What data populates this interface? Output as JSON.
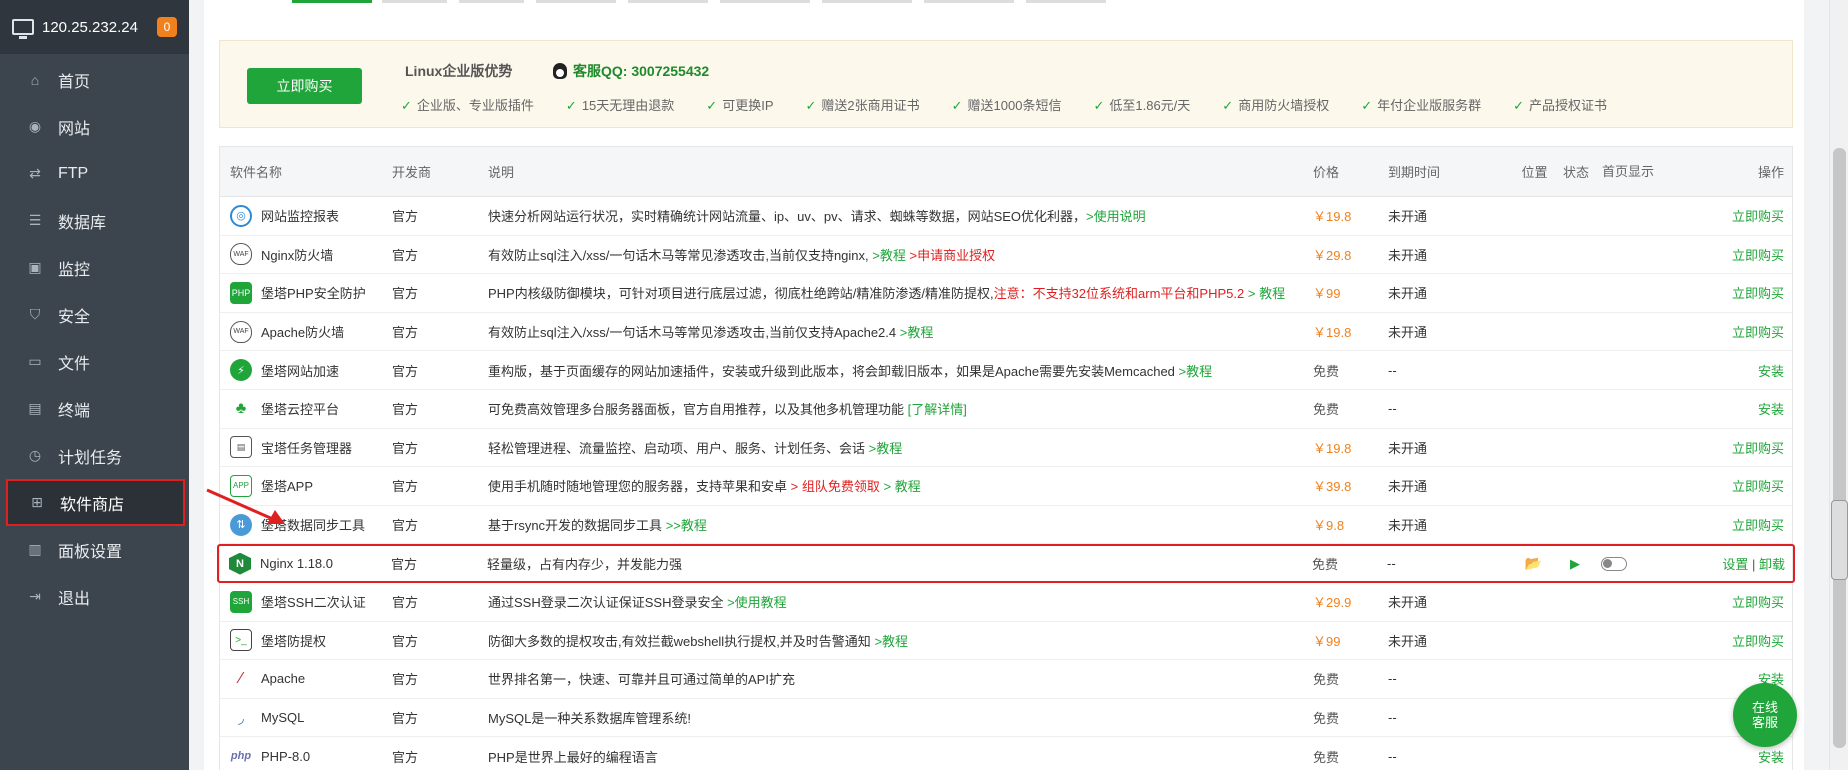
{
  "sidebar": {
    "ip": "120.25.232.24",
    "badge": "0",
    "items": [
      {
        "label": "首页",
        "icon": "home-icon"
      },
      {
        "label": "网站",
        "icon": "globe-icon"
      },
      {
        "label": "FTP",
        "icon": "ftp-icon"
      },
      {
        "label": "数据库",
        "icon": "database-icon"
      },
      {
        "label": "监控",
        "icon": "monitor-icon"
      },
      {
        "label": "安全",
        "icon": "shield-icon"
      },
      {
        "label": "文件",
        "icon": "folder-icon"
      },
      {
        "label": "终端",
        "icon": "terminal-icon"
      },
      {
        "label": "计划任务",
        "icon": "clock-icon"
      },
      {
        "label": "软件商店",
        "icon": "apps-icon"
      },
      {
        "label": "面板设置",
        "icon": "settings-icon"
      },
      {
        "label": "退出",
        "icon": "logout-icon"
      }
    ]
  },
  "promo": {
    "buy": "立即购买",
    "title": "Linux企业版优势",
    "qq": "客服QQ: 3007255432",
    "features": [
      "企业版、专业版插件",
      "15天无理由退款",
      "可更换IP",
      "赠送2张商用证书",
      "赠送1000条短信",
      "低至1.86元/天",
      "商用防火墙授权",
      "年付企业版服务群",
      "产品授权证书"
    ]
  },
  "table": {
    "headers": {
      "name": "软件名称",
      "dev": "开发商",
      "desc": "说明",
      "price": "价格",
      "expire": "到期时间",
      "loc": "位置",
      "status": "状态",
      "home": "首页显示",
      "ops": "操作"
    },
    "rows": [
      {
        "name": "网站监控报表",
        "dev": "官方",
        "desc": "快速分析网站运行状况，实时精确统计网站流量、ip、uv、pv、请求、蜘蛛等数据，网站SEO优化利器，",
        "link1": ">使用说明",
        "price": "￥19.8",
        "expire": "未开通",
        "action": "立即购买"
      },
      {
        "name": "Nginx防火墙",
        "dev": "官方",
        "desc": "有效防止sql注入/xss/一句话木马等常见渗透攻击,当前仅支持nginx,",
        "link1": ">教程",
        "red": ">申请商业授权",
        "price": "￥29.8",
        "expire": "未开通",
        "action": "立即购买"
      },
      {
        "name": "堡塔PHP安全防护",
        "dev": "官方",
        "desc": "PHP内核级防御模块，可针对项目进行底层过滤，彻底杜绝跨站/精准防渗透/精准防提权,",
        "red": "注意：不支持32位系统和arm平台和PHP5.2",
        "link1": "> 教程",
        "price": "￥99",
        "expire": "未开通",
        "action": "立即购买"
      },
      {
        "name": "Apache防火墙",
        "dev": "官方",
        "desc": "有效防止sql注入/xss/一句话木马等常见渗透攻击,当前仅支持Apache2.4",
        "link1": ">教程",
        "price": "￥19.8",
        "expire": "未开通",
        "action": "立即购买"
      },
      {
        "name": "堡塔网站加速",
        "dev": "官方",
        "desc": "重构版，基于页面缓存的网站加速插件，安装或升级到此版本，将会卸载旧版本，如果是Apache需要先安装Memcached",
        "link1": ">教程",
        "price": "免费",
        "expire": "--",
        "action": "安装"
      },
      {
        "name": "堡塔云控平台",
        "dev": "官方",
        "desc": "可免费高效管理多台服务器面板，官方自用推荐，以及其他多机管理功能",
        "link1": "[了解详情]",
        "price": "免费",
        "expire": "--",
        "action": "安装"
      },
      {
        "name": "宝塔任务管理器",
        "dev": "官方",
        "desc": "轻松管理进程、流量监控、启动项、用户、服务、计划任务、会话",
        "link1": ">教程",
        "price": "￥19.8",
        "expire": "未开通",
        "action": "立即购买"
      },
      {
        "name": "堡塔APP",
        "dev": "官方",
        "desc": "使用手机随时随地管理您的服务器，支持苹果和安卓",
        "red": "> 组队免费领取",
        "link1": "> 教程",
        "price": "￥39.8",
        "expire": "未开通",
        "action": "立即购买"
      },
      {
        "name": "堡塔数据同步工具",
        "dev": "官方",
        "desc": "基于rsync开发的数据同步工具",
        "link1": ">>教程",
        "price": "￥9.8",
        "expire": "未开通",
        "action": "立即购买"
      },
      {
        "name": "Nginx 1.18.0",
        "dev": "官方",
        "desc": "轻量级，占有内存少，并发能力强",
        "price": "免费",
        "expire": "--",
        "action": "设置",
        "action2": "卸载",
        "installed": true
      },
      {
        "name": "堡塔SSH二次认证",
        "dev": "官方",
        "desc": "通过SSH登录二次认证保证SSH登录安全",
        "link1": ">使用教程",
        "price": "￥29.9",
        "expire": "未开通",
        "action": "立即购买"
      },
      {
        "name": "堡塔防提权",
        "dev": "官方",
        "desc": "防御大多数的提权攻击,有效拦截webshell执行提权,并及时告警通知",
        "link1": ">教程",
        "price": "￥99",
        "expire": "未开通",
        "action": "立即购买"
      },
      {
        "name": "Apache",
        "dev": "官方",
        "desc": "世界排名第一，快速、可靠并且可通过简单的API扩充",
        "price": "免费",
        "expire": "--",
        "action": "安装"
      },
      {
        "name": "MySQL",
        "dev": "官方",
        "desc": "MySQL是一种关系数据库管理系统!",
        "price": "免费",
        "expire": "--",
        "action": ""
      },
      {
        "name": "PHP-8.0",
        "dev": "官方",
        "desc": "PHP是世界上最好的编程语言",
        "price": "免费",
        "expire": "--",
        "action": "安装"
      }
    ]
  },
  "chat": {
    "line1": "在线",
    "line2": "客服"
  }
}
